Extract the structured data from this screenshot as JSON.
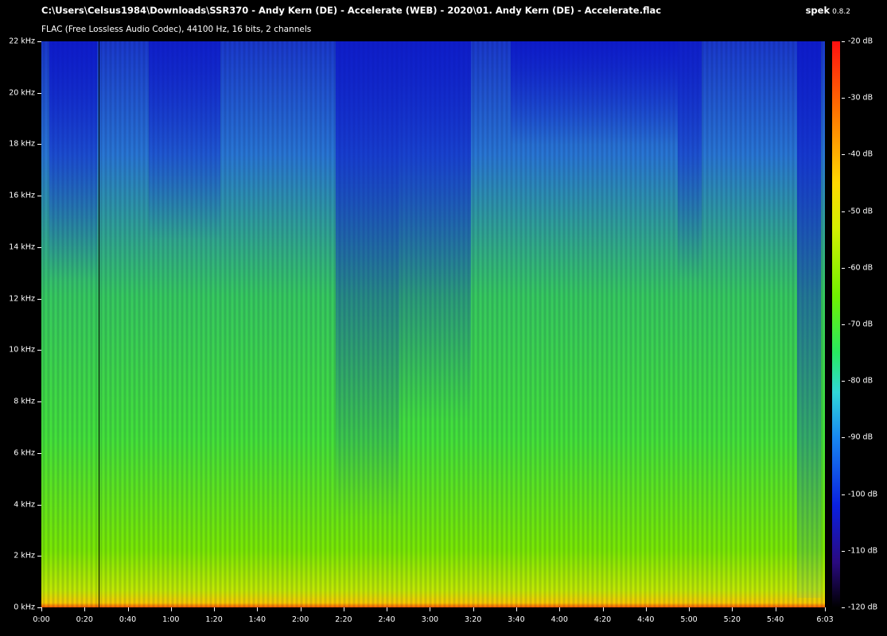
{
  "header": {
    "file_path": "C:\\Users\\Celsus1984\\Downloads\\SSR370 - Andy Kern (DE) - Accelerate (WEB) - 2020\\01. Andy Kern (DE) - Accelerate.flac",
    "codec_info": "FLAC (Free Lossless Audio Codec), 44100 Hz, 16 bits, 2 channels",
    "app_name": "spek",
    "app_version": "0.8.2"
  },
  "frequency_axis": {
    "ticks": [
      "22 kHz",
      "20 kHz",
      "18 kHz",
      "16 kHz",
      "14 kHz",
      "12 kHz",
      "10 kHz",
      "8 kHz",
      "6 kHz",
      "4 kHz",
      "2 kHz",
      "0 kHz"
    ]
  },
  "time_axis": {
    "ticks": [
      "0:00",
      "0:20",
      "0:40",
      "1:00",
      "1:20",
      "1:40",
      "2:00",
      "2:20",
      "2:40",
      "3:00",
      "3:20",
      "3:40",
      "4:00",
      "4:20",
      "4:40",
      "5:00",
      "5:20",
      "5:40",
      "6:03"
    ]
  },
  "color_scale": {
    "ticks": [
      "-20 dB",
      "-30 dB",
      "-40 dB",
      "-50 dB",
      "-60 dB",
      "-70 dB",
      "-80 dB",
      "-90 dB",
      "-100 dB",
      "-110 dB",
      "-120 dB"
    ]
  }
}
